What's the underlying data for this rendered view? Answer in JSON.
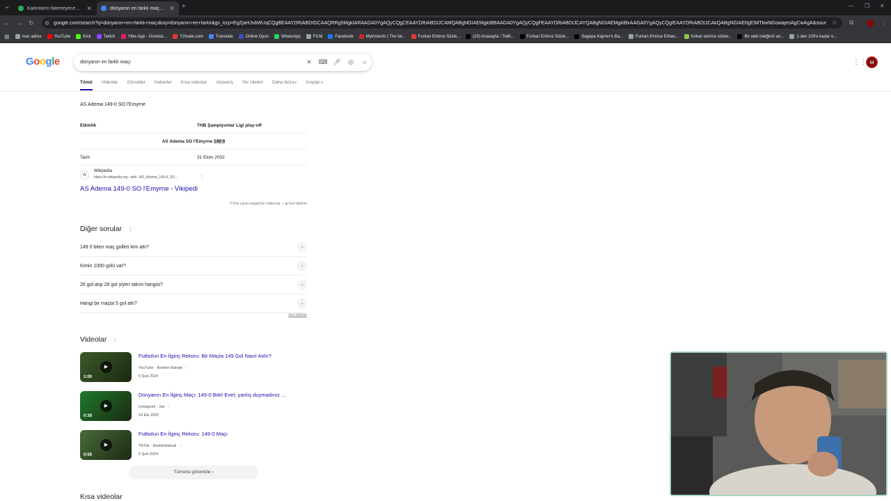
{
  "browser": {
    "tabs": [
      {
        "title": "Kadınların bilemeyeceği şeyler",
        "active": false
      },
      {
        "title": "dünyanın en farklı maçı - Goog",
        "active": true
      }
    ],
    "url": "google.com/search?q=dünyanın+en+farklı+maçı&oq=dünyanın+en+farklı&gs_lcrp=EgZjaHJvbWUqCQgBEAAYDRiABDIGCAAQRRg5MgkIARAAGA0YgAQyCQgCEAAYDRiABDIJCAMQABgNGIAEMgkIBBAAGA0YgAQyCQgFEAAYDRiABDIJCAYQABgNGIAEMgkIBxAAGA0YgAQyCQgIEAAYDRiABDIJCAkQABgNGIAE0gEIMTkwNGowajeoAgCwAgA&sourceid=chrome...",
    "bookmarks": [
      {
        "label": "mac adres",
        "color": "#9aa0a6"
      },
      {
        "label": "YouTube",
        "color": "#ff0000"
      },
      {
        "label": "Kick",
        "color": "#53fc18"
      },
      {
        "label": "Twitch",
        "color": "#9146ff"
      },
      {
        "label": "Ytbe.App - Ücretsiz...",
        "color": "#e91e63"
      },
      {
        "label": "Y2mate.com",
        "color": "#e53935"
      },
      {
        "label": "Translate",
        "color": "#4285f4"
      },
      {
        "label": "Online Oyun",
        "color": "#3f51b5"
      },
      {
        "label": "WhatsApp",
        "color": "#25d366"
      },
      {
        "label": "FILM",
        "color": "#9aa0a6"
      },
      {
        "label": "Facebook",
        "color": "#1877f2"
      },
      {
        "label": "Myinstants | The lar...",
        "color": "#c62828"
      },
      {
        "label": "Furkan Emirce Sözle...",
        "color": "#e53935"
      },
      {
        "label": "(20) Anasayfa / Twitt...",
        "color": "#000000"
      },
      {
        "label": "Furkan Emirce Sözle...",
        "color": "#000000"
      },
      {
        "label": "Sagopa Kajmer'e Ba...",
        "color": "#000000"
      },
      {
        "label": "Furkan Emirce Erhan...",
        "color": "#9aa0a6"
      },
      {
        "label": "furkan emirce sözler...",
        "color": "#8bc34a"
      },
      {
        "label": "Bir web isteğinin an...",
        "color": "#000000"
      },
      {
        "label": "1 den 100'e kadar o...",
        "color": "#9aa0a6"
      }
    ]
  },
  "google": {
    "logo": "Google",
    "query": "dünyanın en farklı maçı",
    "avatar_letter": "M",
    "tabs": [
      "Tümü",
      "Videolar",
      "Görseller",
      "Haberler",
      "Kısa videolar",
      "Alışveriş",
      "Yer siteleri",
      "Daha fazla",
      "Araçlar"
    ]
  },
  "snippet": {
    "title": "AS Adema 149-0 SO l'Emyrne",
    "rows": [
      {
        "k": "Etkinlik",
        "v": "THB Şampiyonlar Ligi play-off"
      },
      {
        "center_a": "AS Adema SO l'Emyrne",
        "center_b": "149 0"
      },
      {
        "k": "Tarih",
        "v": "31 Ekim 2002"
      }
    ],
    "source": "Wikipedia",
    "cite": "https://tr.wikipedia.org › wiki › AS_Adema_149-0_SO...",
    "link": "AS Adema 149-0 SO l'Emyrne - Vikipedi",
    "footer_about": "Öne çıkan snippet'ler hakkında",
    "footer_feedback": "Geri bildirim"
  },
  "paa": {
    "heading": "Diğer sorular",
    "questions": [
      "149 0 biten maç golleri kim attı?",
      "Kimin 1000 golü var?",
      "26 gol atıp 26 gol yiyen takım hangisi?",
      "Hangi bir maçta 5 gol attı?"
    ],
    "feedback": "Geri bildirim"
  },
  "videos": {
    "heading": "Videolar",
    "items": [
      {
        "title": "Futbolun En İlginç Rekoru: Bir Maçta 149 Gol Nasıl Atılır?",
        "source": "YouTube · İbrahim Balsak",
        "date": "5 Şub 2024",
        "duration": "1:00",
        "thumb": "#3d5a2a"
      },
      {
        "title": "Dünyanın En İlginç Maçı: 149-0 Bitti! Evet, yanlış duymadınız ...",
        "source": "Instagram · Ser",
        "date": "18 Eki 2025",
        "duration": "0:38",
        "thumb": "#1f7a2c"
      },
      {
        "title": "Futbolun En İlginç Rekoru: 149-0 Maçı",
        "source": "TikTok · ibrahimbalsak",
        "date": "5 Şub 2024",
        "duration": "0:59",
        "thumb": "#4a6b3a"
      }
    ],
    "show_all": "Tümünü görüntüle"
  },
  "short_videos": {
    "heading": "Kısa videolar"
  },
  "colors": {
    "link": "#1a0dab",
    "chrome_bg": "#202124",
    "cam_border": "#a9d6c6"
  }
}
